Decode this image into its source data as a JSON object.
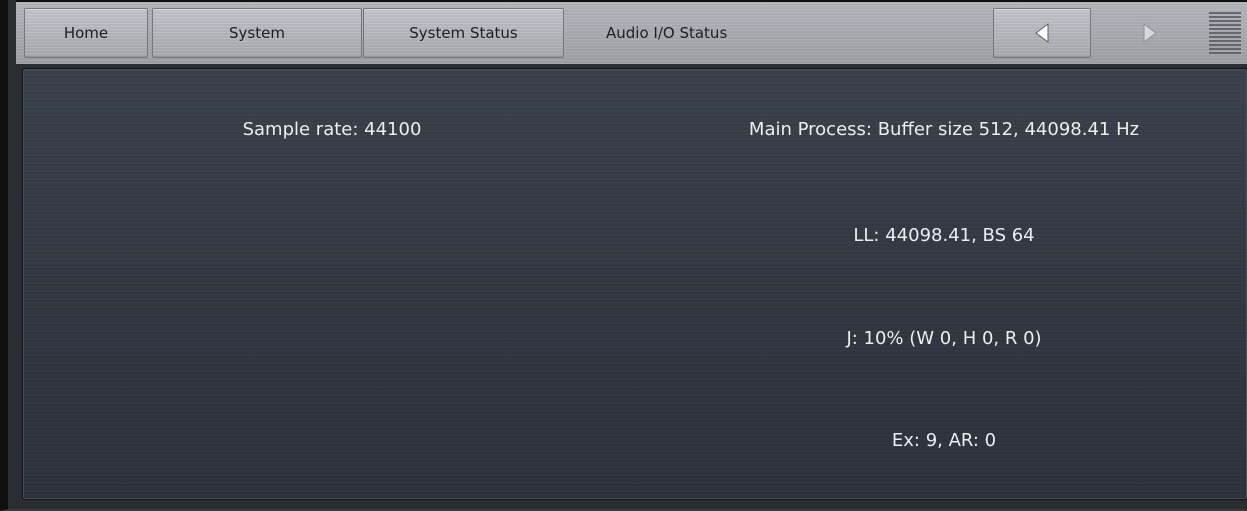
{
  "toolbar": {
    "home_label": "Home",
    "system_label": "System",
    "system_status_label": "System Status",
    "current_page_label": "Audio I/O Status",
    "back_icon": "triangle-left-icon",
    "forward_icon": "triangle-right-icon",
    "menu_icon": "menu-lines-icon"
  },
  "status": {
    "sample_rate": "Sample rate: 44100",
    "main_process": "Main Process: Buffer size 512, 44098.41 Hz",
    "ll": "LL: 44098.41, BS 64",
    "j": "J: 10% (W 0, H 0, R 0)",
    "ex": "Ex: 9, AR: 0"
  },
  "colors": {
    "panel_text": "#ecedef",
    "panel_bg": "#323841",
    "toolbar_bg": "#a8acb1"
  }
}
